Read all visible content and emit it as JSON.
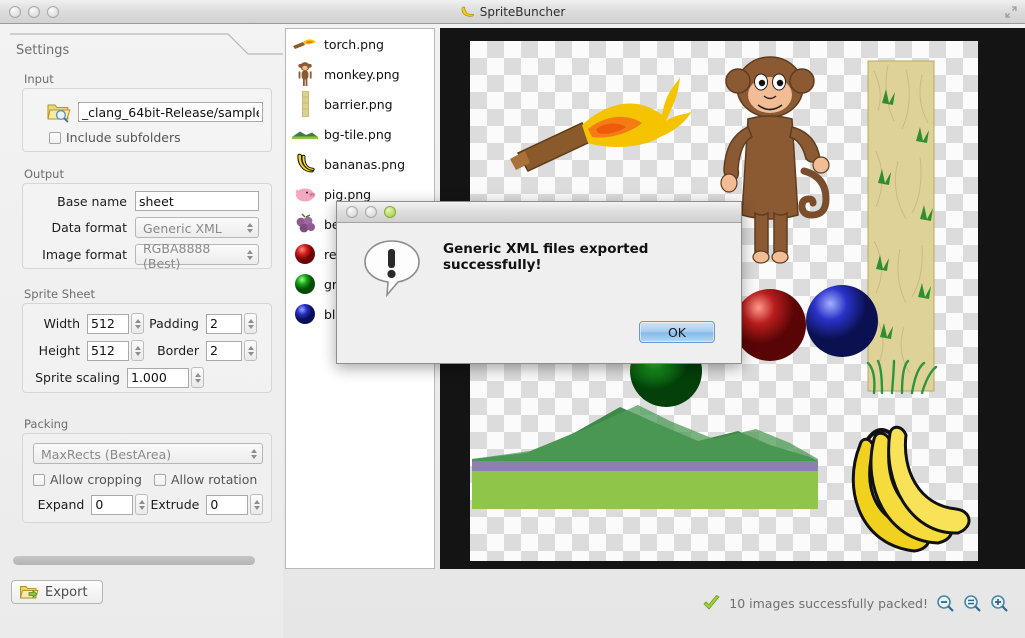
{
  "window": {
    "title": "SpriteBuncher",
    "app_icon": "banana-icon",
    "fullscreen_icon": "fullscreen-icon"
  },
  "settings_tab": {
    "label": "Settings"
  },
  "input_group": {
    "title": "Input",
    "browse_icon": "folder-search-icon",
    "path_value": "_clang_64bit-Release/sample",
    "include_subfolders_label": "Include subfolders",
    "include_subfolders_checked": false
  },
  "output_group": {
    "title": "Output",
    "base_name_label": "Base name",
    "base_name_value": "sheet",
    "data_format_label": "Data format",
    "data_format_value": "Generic XML",
    "image_format_label": "Image format",
    "image_format_value": "RGBA8888 (Best)"
  },
  "sprite_sheet_group": {
    "title": "Sprite Sheet",
    "width_label": "Width",
    "width_value": "512",
    "padding_label": "Padding",
    "padding_value": "2",
    "height_label": "Height",
    "height_value": "512",
    "border_label": "Border",
    "border_value": "2",
    "sprite_scaling_label": "Sprite scaling",
    "sprite_scaling_value": "1.000"
  },
  "packing_group": {
    "title": "Packing",
    "algorithm_value": "MaxRects (BestArea)",
    "allow_cropping_label": "Allow cropping",
    "allow_cropping_checked": false,
    "allow_rotation_label": "Allow rotation",
    "allow_rotation_checked": false,
    "expand_label": "Expand",
    "expand_value": "0",
    "extrude_label": "Extrude",
    "extrude_value": "0"
  },
  "export_button": {
    "label": "Export",
    "icon": "folder-export-icon"
  },
  "file_list": {
    "items": [
      {
        "name": "torch.png",
        "icon": "torch-thumb"
      },
      {
        "name": "monkey.png",
        "icon": "monkey-thumb"
      },
      {
        "name": "barrier.png",
        "icon": "barrier-thumb"
      },
      {
        "name": "bg-tile.png",
        "icon": "bgtile-thumb"
      },
      {
        "name": "bananas.png",
        "icon": "bananas-thumb"
      },
      {
        "name": "pig.png",
        "icon": "pig-thumb"
      },
      {
        "name": "berries.png",
        "icon": "berries-thumb"
      },
      {
        "name": "red.png",
        "icon": "red-ball-thumb"
      },
      {
        "name": "green.png",
        "icon": "green-ball-thumb"
      },
      {
        "name": "blue.png",
        "icon": "blue-ball-thumb"
      }
    ]
  },
  "statusbar": {
    "check_icon": "green-check-icon",
    "message": "10 images successfully packed!",
    "zoom_out_icon": "zoom-out-icon",
    "zoom_fit_icon": "zoom-fit-icon",
    "zoom_in_icon": "zoom-in-icon"
  },
  "dialog": {
    "message": "Generic XML files exported successfully!",
    "ok_label": "OK",
    "alert_icon": "exclamation-speech-bubble-icon"
  },
  "colors": {
    "accent_blue": "#86bbe9",
    "canvas_bg": "#141414",
    "panel_bg": "#efefef",
    "status_green": "#8fc63d"
  }
}
